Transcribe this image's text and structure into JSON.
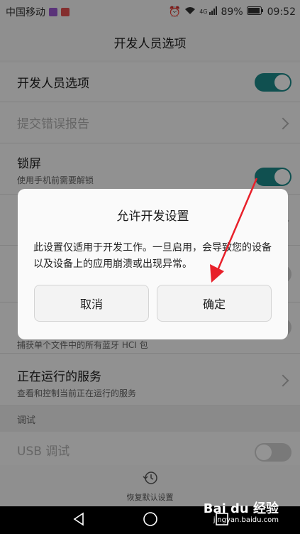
{
  "status_bar": {
    "carrier": "中国移动",
    "network": "4G",
    "battery": "89%",
    "time": "09:52"
  },
  "app_bar": {
    "title": "开发人员选项"
  },
  "rows": [
    {
      "title": "开发人员选项",
      "toggle": true
    },
    {
      "title": "提交错误报告",
      "disabled": true
    },
    {
      "title": "锁屏",
      "subtitle": "使用手机前需要解锁",
      "toggle": true
    },
    {
      "subtitle": "捕获单个文件中的所有蓝牙 HCI 包"
    },
    {
      "title": "正在运行的服务",
      "subtitle": "查看和控制当前正在运行的服务"
    }
  ],
  "section": {
    "debug_header": "调试"
  },
  "usb_row": {
    "title": "USB 调试"
  },
  "bottom_action": {
    "label": "恢复默认设置"
  },
  "dialog": {
    "title": "允许开发设置",
    "message": "此设置仅适用于开发工作。一旦启用，会导致您的设备以及设备上的应用崩溃或出现异常。",
    "cancel_label": "取消",
    "ok_label": "确定"
  },
  "watermark": {
    "logo": "Bai du 经验",
    "url": "jingyan.baidu.com"
  },
  "colors": {
    "accent": "#1d8a8a",
    "annotation_arrow": "#e8202a"
  }
}
